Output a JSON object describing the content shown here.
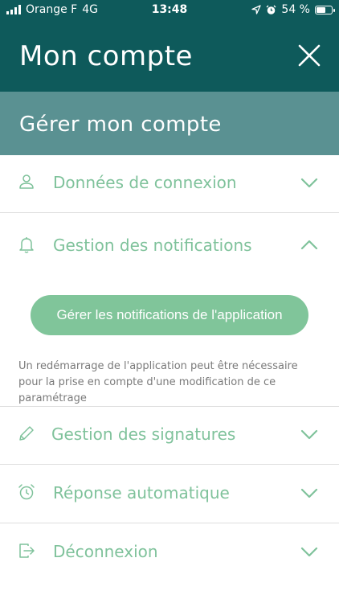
{
  "status_bar": {
    "carrier": "Orange F",
    "network": "4G",
    "time": "13:48",
    "battery": "54 %"
  },
  "header": {
    "title": "Mon compte"
  },
  "section": {
    "title": "Gérer mon compte"
  },
  "items": [
    {
      "label": "Données de connexion",
      "icon": "user-icon",
      "expanded": false
    },
    {
      "label": "Gestion des notifications",
      "icon": "bell-icon",
      "expanded": true
    },
    {
      "label": "Gestion des signatures",
      "icon": "pencil-icon",
      "expanded": false
    },
    {
      "label": "Réponse automatique",
      "icon": "alarm-clock-icon",
      "expanded": false
    },
    {
      "label": "Déconnexion",
      "icon": "logout-icon",
      "expanded": false
    }
  ],
  "notifications": {
    "button_label": "Gérer les notifications de l'application",
    "note": "Un redémarrage de l'application peut être nécessaire pour la prise en compte d'une modification de ce paramétrage"
  },
  "colors": {
    "header_bg": "#0e5a5b",
    "section_bg": "#5a9192",
    "accent": "#7fc29b"
  }
}
